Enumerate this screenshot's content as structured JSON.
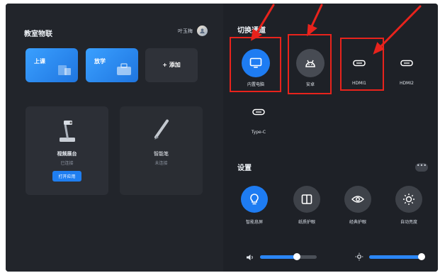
{
  "left_panel": {
    "title": "教室物联",
    "user_name": "叶玉梅",
    "mode_buttons": [
      {
        "label": "上课",
        "icon": "classroom-icon"
      },
      {
        "label": "放学",
        "icon": "briefcase-icon"
      },
      {
        "label": "+ 添加",
        "icon": "plus-icon"
      }
    ],
    "devices": [
      {
        "name": "视频展台",
        "status": "已连接",
        "action": "打开应用",
        "icon": "document-camera-icon"
      },
      {
        "name": "智能笔",
        "status": "未连接",
        "icon": "smart-pen-icon"
      }
    ]
  },
  "right_panel": {
    "source_title": "切换通道",
    "sources": [
      {
        "label": "内置电脑",
        "icon": "monitor-icon",
        "active": true
      },
      {
        "label": "安卓",
        "icon": "android-icon",
        "active": false
      },
      {
        "label": "HDMI1",
        "icon": "hdmi-port-icon",
        "active": false
      },
      {
        "label": "HDMI2",
        "icon": "hdmi-port-icon",
        "active": false
      },
      {
        "label": "Type-C",
        "icon": "usb-c-icon",
        "active": false
      }
    ],
    "settings_title": "设置",
    "more_label": "•••",
    "settings": [
      {
        "label": "智能息屏",
        "icon": "lightbulb-icon",
        "active": true
      },
      {
        "label": "纸质护眼",
        "icon": "book-icon",
        "active": false
      },
      {
        "label": "经典护眼",
        "icon": "eye-icon",
        "active": false
      },
      {
        "label": "自动亮度",
        "icon": "sun-icon",
        "active": false
      }
    ],
    "volume_level": 0.65,
    "brightness_level": 0.95
  },
  "annotations": {
    "highlight_color": "#e8231c",
    "arrow_color": "#e8231c"
  },
  "colors": {
    "accent": "#1e7cf2",
    "background": "#23262c"
  }
}
